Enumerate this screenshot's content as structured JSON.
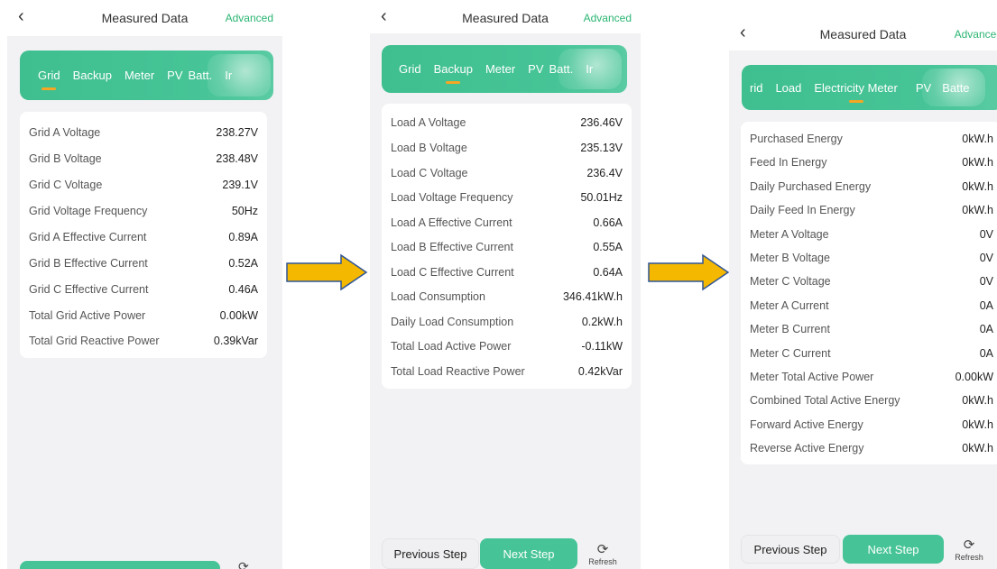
{
  "screens": [
    {
      "header": {
        "back_icon": "chevron-left-icon",
        "title": "Measured Data",
        "advanced": "Advanced"
      },
      "tabs": [
        "Grid",
        "Backup",
        "Meter",
        "PV",
        "Batt.",
        "Ir"
      ],
      "selected_tab": "Grid",
      "rows": [
        {
          "label": "Grid A Voltage",
          "value": "238.27V"
        },
        {
          "label": "Grid B Voltage",
          "value": "238.48V"
        },
        {
          "label": "Grid C Voltage",
          "value": "239.1V"
        },
        {
          "label": "Grid Voltage Frequency",
          "value": "50Hz"
        },
        {
          "label": "Grid A Effective Current",
          "value": "0.89A"
        },
        {
          "label": "Grid B Effective Current",
          "value": "0.52A"
        },
        {
          "label": "Grid C Effective Current",
          "value": "0.46A"
        },
        {
          "label": "Total Grid Active Power",
          "value": "0.00kW"
        },
        {
          "label": "Total Grid Reactive Power",
          "value": "0.39kVar"
        }
      ]
    },
    {
      "header": {
        "back_icon": "chevron-left-icon",
        "title": "Measured Data",
        "advanced": "Advanced"
      },
      "tabs": [
        "Grid",
        "Backup",
        "Meter",
        "PV",
        "Batt.",
        "Ir"
      ],
      "selected_tab": "Backup",
      "rows": [
        {
          "label": "Load A Voltage",
          "value": "236.46V"
        },
        {
          "label": "Load B Voltage",
          "value": "235.13V"
        },
        {
          "label": "Load C Voltage",
          "value": "236.4V"
        },
        {
          "label": "Load Voltage Frequency",
          "value": "50.01Hz"
        },
        {
          "label": "Load A Effective Current",
          "value": "0.66A"
        },
        {
          "label": "Load B Effective Current",
          "value": "0.55A"
        },
        {
          "label": "Load C Effective Current",
          "value": "0.64A"
        },
        {
          "label": "Load Consumption",
          "value": "346.41kW.h"
        },
        {
          "label": "Daily Load Consumption",
          "value": "0.2kW.h"
        },
        {
          "label": "Total Load Active Power",
          "value": "-0.11kW"
        },
        {
          "label": "Total Load Reactive Power",
          "value": "0.42kVar"
        }
      ],
      "footer": {
        "previous": "Previous Step",
        "next": "Next Step",
        "refresh": "Refresh",
        "refresh_icon": "refresh-icon"
      }
    },
    {
      "header": {
        "back_icon": "chevron-left-icon",
        "title": "Measured Data",
        "advanced": "Advanced"
      },
      "tabs": [
        "rid",
        "Load",
        "Electricity Meter",
        "PV",
        "Batte"
      ],
      "selected_tab": "Electricity Meter",
      "rows": [
        {
          "label": "Purchased Energy",
          "value": "0kW.h"
        },
        {
          "label": "Feed In Energy",
          "value": "0kW.h"
        },
        {
          "label": "Daily Purchased Energy",
          "value": "0kW.h"
        },
        {
          "label": "Daily Feed In Energy",
          "value": "0kW.h"
        },
        {
          "label": "Meter A Voltage",
          "value": "0V"
        },
        {
          "label": "Meter B Voltage",
          "value": "0V"
        },
        {
          "label": "Meter C Voltage",
          "value": "0V"
        },
        {
          "label": "Meter A Current",
          "value": "0A"
        },
        {
          "label": "Meter B Current",
          "value": "0A"
        },
        {
          "label": "Meter C Current",
          "value": "0A"
        },
        {
          "label": "Meter Total Active Power",
          "value": "0.00kW"
        },
        {
          "label": "Combined Total Active Energy",
          "value": "0kW.h"
        },
        {
          "label": "Forward Active Energy",
          "value": "0kW.h"
        },
        {
          "label": "Reverse Active Energy",
          "value": "0kW.h"
        }
      ],
      "footer": {
        "previous": "Previous Step",
        "next": "Next Step",
        "refresh": "Refresh",
        "refresh_icon": "refresh-icon"
      }
    }
  ],
  "arrow_icon": "arrow-right-icon",
  "colors": {
    "accent": "#46c497",
    "tab_indicator": "#f5a623",
    "arrow": "#f5b800",
    "link": "#2bb673"
  }
}
